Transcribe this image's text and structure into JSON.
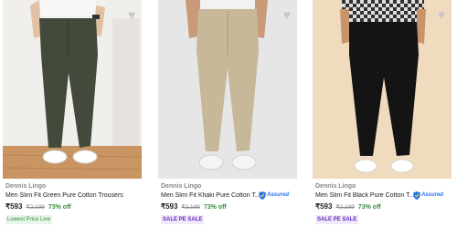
{
  "colors": {
    "price_off": "#388e3c",
    "assured": "#2874f0",
    "sale_tag": "#6a2bc2",
    "lowest_tag": "#388e3c"
  },
  "products": [
    {
      "brand": "Dennis Lingo",
      "title": "Men Slim Fit Green Pure Cotton Trousers",
      "price": "₹593",
      "mrp": "₹2,199",
      "discount": "73% off",
      "assured": false,
      "tag": "Lowest Price Live",
      "icons": [
        "heart-icon"
      ]
    },
    {
      "brand": "Dennis Lingo",
      "title": "Men Slim Fit Khaki Pure Cotton T...",
      "assured_label": "Assured",
      "price": "₹593",
      "mrp": "₹2,199",
      "discount": "73% off",
      "assured": true,
      "tag": "SALE PE SALE",
      "icons": [
        "heart-icon",
        "assured-shield-icon"
      ]
    },
    {
      "brand": "Dennis Lingo",
      "title": "Men Slim Fit Black Pure Cotton T...",
      "assured_label": "Assured",
      "price": "₹593",
      "mrp": "₹2,199",
      "discount": "73% off",
      "assured": true,
      "tag": "SALE PE SALE",
      "icons": [
        "heart-icon",
        "assured-shield-icon"
      ]
    }
  ]
}
